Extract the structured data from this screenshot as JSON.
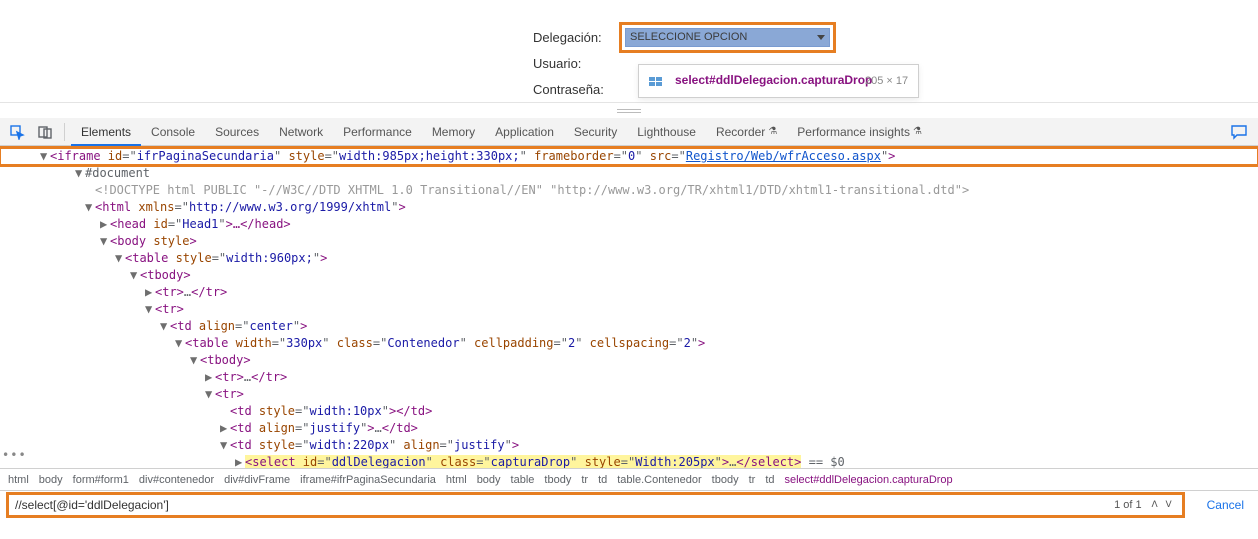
{
  "form": {
    "delegacion_label": "Delegación:",
    "usuario_label": "Usuario:",
    "contrasena_label": "Contraseña:",
    "ddl_text": "SELECCIONE OPCION"
  },
  "tooltip": {
    "selector": "select#ddlDelegacion.capturaDrop",
    "dimensions": "205 × 17"
  },
  "tabs": {
    "elements": "Elements",
    "console": "Console",
    "sources": "Sources",
    "network": "Network",
    "performance": "Performance",
    "memory": "Memory",
    "application": "Application",
    "security": "Security",
    "lighthouse": "Lighthouse",
    "recorder": "Recorder",
    "perf_insights": "Performance insights"
  },
  "dom": {
    "l1_open": "▼",
    "l1_a": "<iframe ",
    "l1_b": "id",
    "l1_c": "=\"",
    "l1_d": "ifrPaginaSecundaria",
    "l1_e": "\" ",
    "l1_f": "style",
    "l1_g": "width:985px;height:330px;",
    "l1_h": "frameborder",
    "l1_i": "0",
    "l1_j": "src",
    "l1_k": "Registro/Web/wfrAcceso.aspx",
    "l1_l": ">",
    "l2": "▼#document",
    "l3": "<!DOCTYPE html PUBLIC \"-//W3C//DTD XHTML 1.0 Transitional//EN\" \"http://www.w3.org/TR/xhtml1/DTD/xhtml1-transitional.dtd\">",
    "l4_a": "<html ",
    "l4_b": "xmlns",
    "l4_c": "http://www.w3.org/1999/xhtml",
    "l4_d": ">",
    "l5_a": "<head ",
    "l5_b": "id",
    "l5_c": "Head1",
    "l5_d": ">…</head>",
    "l6_a": "<body ",
    "l6_b": "style",
    "l6_c": ">",
    "l7_a": "<table ",
    "l7_b": "style",
    "l7_c": "width:960px;",
    "l7_d": ">",
    "l8": "<tbody>",
    "l9": "<tr>…</tr>",
    "l10": "<tr>",
    "l11_a": "<td ",
    "l11_b": "align",
    "l11_c": "center",
    "l11_d": ">",
    "l12_a": "<table ",
    "l12_b": "width",
    "l12_c": "330px",
    "l12_d": "class",
    "l12_e": "Contenedor",
    "l12_f": "cellpadding",
    "l12_g": "2",
    "l12_h": "cellspacing",
    "l12_i": ">",
    "l13": "<tbody>",
    "l14": "<tr>…</tr>",
    "l15": "<tr>",
    "l16_a": "<td ",
    "l16_b": "style",
    "l16_c": "width:10px",
    "l16_d": "></td>",
    "l17_a": "<td ",
    "l17_b": "align",
    "l17_c": "justify",
    "l17_d": ">…</td>",
    "l18_a": "<td ",
    "l18_b": "style",
    "l18_c": "width:220px",
    "l18_d": "align",
    "l18_e": "justify",
    "l18_f": ">",
    "l19_a": "<select ",
    "l19_b": "id",
    "l19_c": "ddlDelegacion",
    "l19_d": "class",
    "l19_e": "capturaDrop",
    "l19_f": "style",
    "l19_g": "Width:205px",
    "l19_h": ">…</select>",
    "l19_i": " == $0"
  },
  "crumb": {
    "c1": "html",
    "c2": "body",
    "c3": "form#form1",
    "c4": "div#contenedor",
    "c5": "div#divFrame",
    "c6": "iframe#ifrPaginaSecundaria",
    "c7": "html",
    "c8": "body",
    "c9": "table",
    "c10": "tbody",
    "c11": "tr",
    "c12": "td",
    "c13": "table.Contenedor",
    "c14": "tbody",
    "c15": "tr",
    "c16": "td",
    "c17": "select#ddlDelegacion.capturaDrop"
  },
  "search": {
    "value": "//select[@id='ddlDelegacion']",
    "count": "1 of 1",
    "cancel": "Cancel"
  },
  "dots": "•••"
}
